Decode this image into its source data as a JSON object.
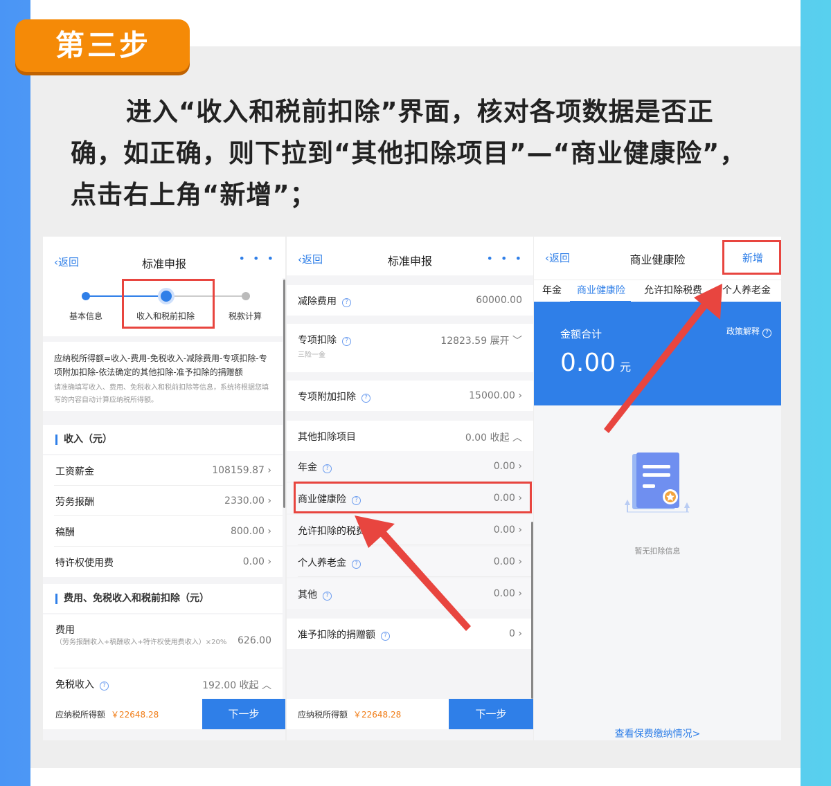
{
  "step_label": "第三步",
  "instruction": "进入“收入和税前扣除”界面，核对各项数据是否正确，如正确，则下拉到“其他扣除项目”—“商业健康险”，点击右上角“新增”；",
  "colors": {
    "accent": "#2f7fe8",
    "orange": "#f58a07",
    "highlight": "#e8453f",
    "amount": "#f07a12"
  },
  "screen1": {
    "back": "返回",
    "title": "标准申报",
    "more": "• • •",
    "steps": [
      "基本信息",
      "收入和税前扣除",
      "税款计算"
    ],
    "formula": "应纳税所得额=收入-费用-免税收入-减除费用-专项扣除-专项附加扣除-依法确定的其他扣除-准予扣除的捐赠额",
    "hint": "请准确填写收入、费用、免税收入和税前扣除等信息，系统将根据您填写的内容自动计算应纳税所得额。",
    "income_header": "收入（元）",
    "income": [
      {
        "label": "工资薪金",
        "value": "108159.87",
        "chev": "›"
      },
      {
        "label": "劳务报酬",
        "value": "2330.00",
        "chev": "›"
      },
      {
        "label": "稿酬",
        "value": "800.00",
        "chev": "›"
      },
      {
        "label": "特许权使用费",
        "value": "0.00",
        "chev": "›"
      }
    ],
    "expense_header": "费用、免税收入和税前扣除（元）",
    "fee_label": "费用",
    "fee_note": "（劳务报酬收入+稿酬收入+特许权使用费收入）×20%",
    "fee_value": "626.00",
    "taxfree_label": "免税收入",
    "taxfree_value": "192.00 收起 ︿",
    "bottom_label": "应纳税所得额",
    "bottom_amount": "￥22648.28",
    "next": "下一步"
  },
  "screen2": {
    "back": "返回",
    "title": "标准申报",
    "more": "• • •",
    "q": "?",
    "reduce": {
      "label": "减除费用",
      "value": "60000.00"
    },
    "special": {
      "label": "专项扣除",
      "sub": "三险一金",
      "value": "12823.59 展开 ﹀"
    },
    "special_add": {
      "label": "专项附加扣除",
      "value": "15000.00 ›"
    },
    "other_header": {
      "label": "其他扣除项目",
      "value": "0.00 收起 ︿"
    },
    "items": [
      {
        "label": "年金",
        "value": "0.00 ›"
      },
      {
        "label": "商业健康险",
        "value": "0.00 ›"
      },
      {
        "label": "允许扣除的税费",
        "value": "0.00 ›"
      },
      {
        "label": "个人养老金",
        "value": "0.00 ›"
      },
      {
        "label": "其他",
        "value": "0.00 ›"
      }
    ],
    "donation": {
      "label": "准予扣除的捐赠额",
      "value": "0 ›"
    },
    "bottom_label": "应纳税所得额",
    "bottom_amount": "￥22648.28",
    "next": "下一步"
  },
  "screen3": {
    "back": "返回",
    "title": "商业健康险",
    "add": "新增",
    "tabs": [
      "年金",
      "商业健康险",
      "允许扣除税费",
      "个人养老金"
    ],
    "total_label": "金额合计",
    "total_value": "0.00",
    "unit": "元",
    "policy": "政策解释",
    "empty": "暂无扣除信息",
    "link": "查看保费缴纳情况>"
  }
}
